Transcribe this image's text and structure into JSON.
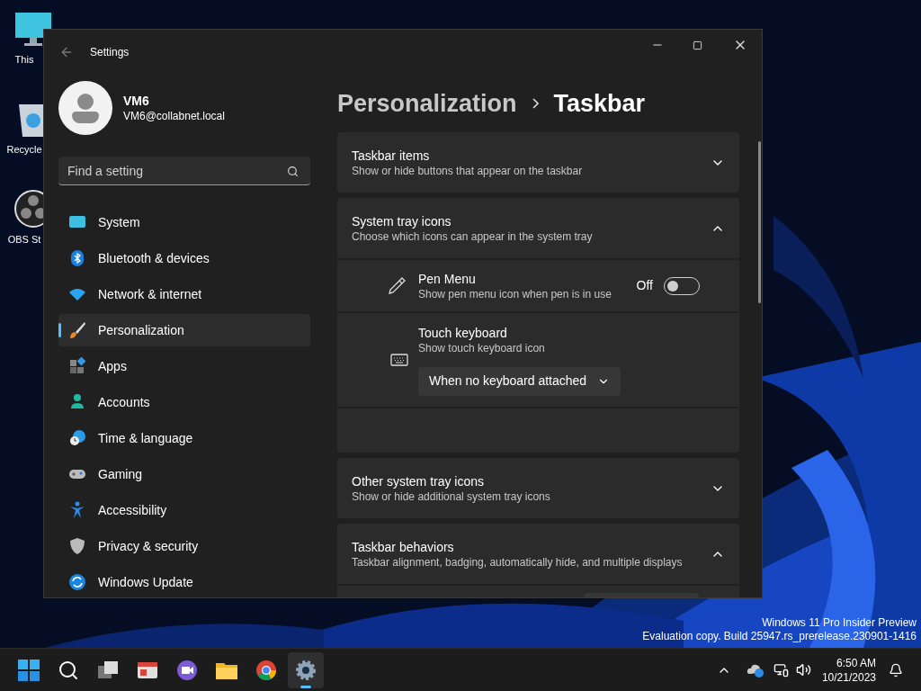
{
  "desktop": {
    "icons": [
      {
        "label": "This",
        "kind": "monitor"
      },
      {
        "label": "Recycle",
        "kind": "recycle"
      },
      {
        "label": "OBS St",
        "kind": "obs"
      }
    ],
    "watermark_lines": [
      "Windows 11 Pro Insider Preview",
      "Evaluation copy. Build 25947.rs_prerelease.230901-1416"
    ]
  },
  "window": {
    "title": "Settings",
    "user": {
      "name": "VM6",
      "email": "VM6@collabnet.local"
    },
    "search": {
      "placeholder": "Find a setting"
    },
    "nav": [
      {
        "label": "System",
        "kind": "system",
        "selected": false
      },
      {
        "label": "Bluetooth & devices",
        "kind": "bluetooth",
        "selected": false
      },
      {
        "label": "Network & internet",
        "kind": "network",
        "selected": false
      },
      {
        "label": "Personalization",
        "kind": "brush",
        "selected": true
      },
      {
        "label": "Apps",
        "kind": "apps",
        "selected": false
      },
      {
        "label": "Accounts",
        "kind": "accounts",
        "selected": false
      },
      {
        "label": "Time & language",
        "kind": "time",
        "selected": false
      },
      {
        "label": "Gaming",
        "kind": "gaming",
        "selected": false
      },
      {
        "label": "Accessibility",
        "kind": "accessibility",
        "selected": false
      },
      {
        "label": "Privacy & security",
        "kind": "privacy",
        "selected": false
      },
      {
        "label": "Windows Update",
        "kind": "update",
        "selected": false
      }
    ],
    "breadcrumb": [
      "Personalization",
      "Taskbar"
    ],
    "sections": [
      {
        "title": "Taskbar items",
        "subtitle": "Show or hide buttons that appear on the taskbar",
        "expanded": false
      },
      {
        "title": "System tray icons",
        "subtitle": "Choose which icons can appear in the system tray",
        "expanded": true,
        "items": [
          {
            "kind": "toggle",
            "title": "Pen Menu",
            "subtitle": "Show pen menu icon when pen is in use",
            "on": false,
            "state_label": "Off"
          },
          {
            "kind": "dropdown",
            "title": "Touch keyboard",
            "subtitle": "Show touch keyboard icon",
            "value": "When no keyboard attached"
          },
          {
            "kind": "blank"
          }
        ]
      },
      {
        "title": "Other system tray icons",
        "subtitle": "Show or hide additional system tray icons",
        "expanded": false
      },
      {
        "title": "Taskbar behaviors",
        "subtitle": "Taskbar alignment, badging, automatically hide, and multiple displays",
        "expanded": true,
        "items": [
          {
            "kind": "cut"
          }
        ]
      }
    ]
  },
  "taskbar": {
    "apps": [
      {
        "kind": "start",
        "active": false
      },
      {
        "kind": "search",
        "active": false
      },
      {
        "kind": "taskview",
        "active": false
      },
      {
        "kind": "widgets",
        "active": false
      },
      {
        "kind": "chat",
        "active": false
      },
      {
        "kind": "folder",
        "active": false
      },
      {
        "kind": "browser",
        "active": false
      },
      {
        "kind": "settings",
        "active": true
      }
    ],
    "time": "6:50 AM",
    "date": "10/21/2023"
  }
}
